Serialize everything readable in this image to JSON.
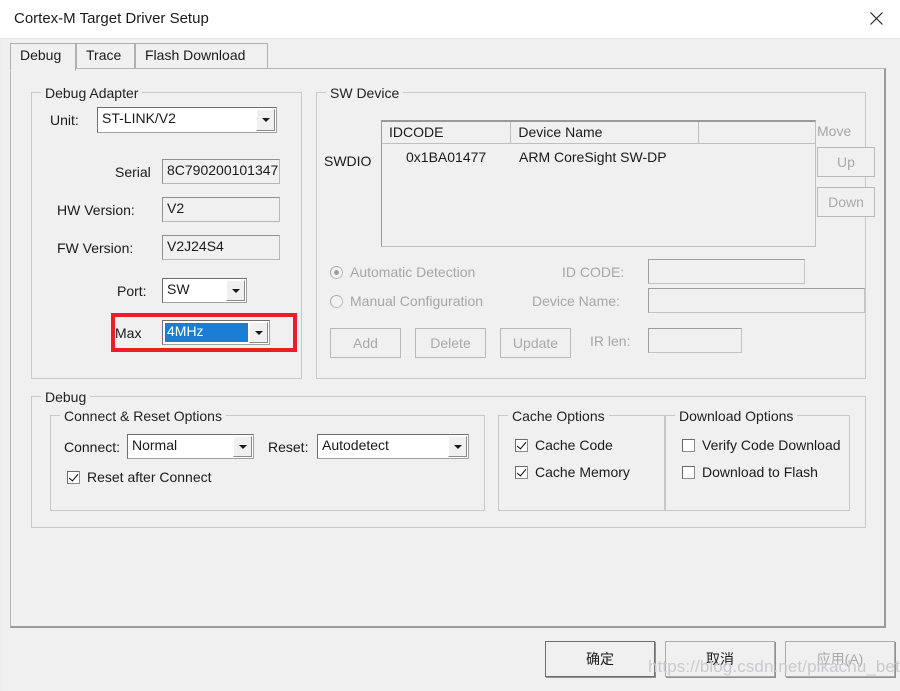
{
  "window": {
    "title": "Cortex-M Target Driver Setup",
    "close_icon": "close-icon"
  },
  "tabs": [
    {
      "label": "Debug",
      "active": true
    },
    {
      "label": "Trace",
      "active": false
    },
    {
      "label": "Flash Download",
      "active": false
    }
  ],
  "debug_adapter": {
    "title": "Debug Adapter",
    "unit_label": "Unit:",
    "unit_value": "ST-LINK/V2",
    "serial_label": "Serial",
    "serial_value": "8C790200101347",
    "hw_version_label": "HW Version:",
    "hw_version_value": "V2",
    "fw_version_label": "FW Version:",
    "fw_version_value": "V2J24S4",
    "port_label": "Port:",
    "port_value": "SW",
    "max_label": "Max",
    "max_value": "4MHz",
    "highlight_color": "#ee1c25"
  },
  "sw_device": {
    "title": "SW Device",
    "swdio_label": "SWDIO",
    "columns": [
      "IDCODE",
      "Device Name",
      ""
    ],
    "rows": [
      {
        "idcode": "0x1BA01477",
        "device_name": "ARM CoreSight SW-DP",
        "extra": ""
      }
    ],
    "move_label": "Move",
    "up_label": "Up",
    "down_label": "Down",
    "automatic_detection_label": "Automatic Detection",
    "manual_configuration_label": "Manual Configuration",
    "detection_mode": "automatic",
    "id_code_label": "ID CODE:",
    "id_code_value": "",
    "device_name_label": "Device Name:",
    "device_name_value": "",
    "ir_len_label": "IR len:",
    "ir_len_value": "",
    "add_label": "Add",
    "delete_label": "Delete",
    "update_label": "Update"
  },
  "debug_section": {
    "title": "Debug",
    "connect_reset": {
      "title": "Connect & Reset Options",
      "connect_label": "Connect:",
      "connect_value": "Normal",
      "reset_label": "Reset:",
      "reset_value": "Autodetect",
      "reset_after_connect_label": "Reset after Connect",
      "reset_after_connect_checked": true
    },
    "cache_options": {
      "title": "Cache Options",
      "cache_code_label": "Cache Code",
      "cache_code_checked": true,
      "cache_memory_label": "Cache Memory",
      "cache_memory_checked": true
    },
    "download_options": {
      "title": "Download Options",
      "verify_code_download_label": "Verify Code Download",
      "verify_code_download_checked": false,
      "download_to_flash_label": "Download to Flash",
      "download_to_flash_checked": false
    }
  },
  "footer": {
    "ok_label": "确定",
    "cancel_label": "取消",
    "apply_label": "应用(A)"
  },
  "watermark": {
    "text": "https://blog.csdn.net/pikachu_beta"
  }
}
